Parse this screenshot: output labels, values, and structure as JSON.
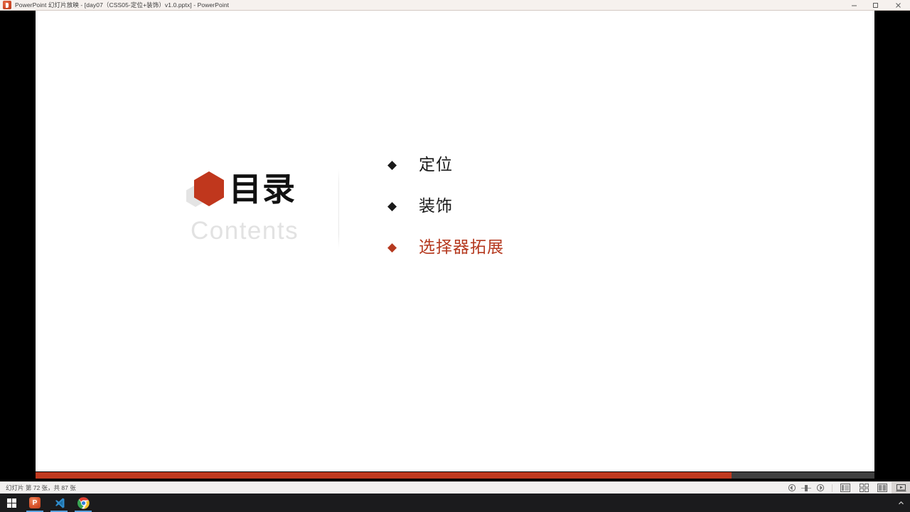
{
  "window": {
    "app_icon": "powerpoint-icon",
    "title": "PowerPoint 幻灯片放映  -  [day07（CSS05-定位+装饰）v1.0.pptx]  -  PowerPoint",
    "controls": [
      {
        "name": "minimize-button",
        "glyph": "minimize-icon"
      },
      {
        "name": "maximize-button",
        "glyph": "maximize-icon"
      },
      {
        "name": "close-button",
        "glyph": "close-icon"
      }
    ]
  },
  "slide": {
    "logo": {
      "front_hex_color": "#c0371d",
      "back_hex_color": "#e4e4e4"
    },
    "heading_cn": "目录",
    "heading_en": "Contents",
    "accent_color": "#b5391f",
    "items": [
      {
        "label": "定位",
        "bullet": "◆",
        "state": "dark"
      },
      {
        "label": "装饰",
        "bullet": "◆",
        "state": "dark"
      },
      {
        "label": "选择器拓展",
        "bullet": "◆",
        "state": "accent"
      }
    ]
  },
  "progress": {
    "percent": 83,
    "fill_color": "#c0391f",
    "track_color": "#3f3f3f"
  },
  "statusbar": {
    "slide_text": "幻灯片 第 72 张，共 87 张",
    "zoom_out": "zoom-out-icon",
    "zoom_slider": "zoom-slider",
    "zoom_in": "zoom-in-icon",
    "views": [
      {
        "name": "normal-view-button",
        "icon": "normal-view-icon",
        "active": false
      },
      {
        "name": "slide-sorter-button",
        "icon": "slide-sorter-icon",
        "active": false
      },
      {
        "name": "reading-view-button",
        "icon": "reading-view-icon",
        "active": false
      },
      {
        "name": "slide-show-button",
        "icon": "slide-show-icon",
        "active": true
      }
    ]
  },
  "taskbar": {
    "start": "windows-start-icon",
    "apps": [
      {
        "name": "taskbar-powerpoint",
        "icon": "powerpoint-icon"
      },
      {
        "name": "taskbar-vscode",
        "icon": "vscode-icon"
      },
      {
        "name": "taskbar-chrome",
        "icon": "chrome-icon"
      }
    ],
    "tray": [
      {
        "name": "show-hidden-icons",
        "icon": "chevron-up-icon"
      }
    ]
  }
}
